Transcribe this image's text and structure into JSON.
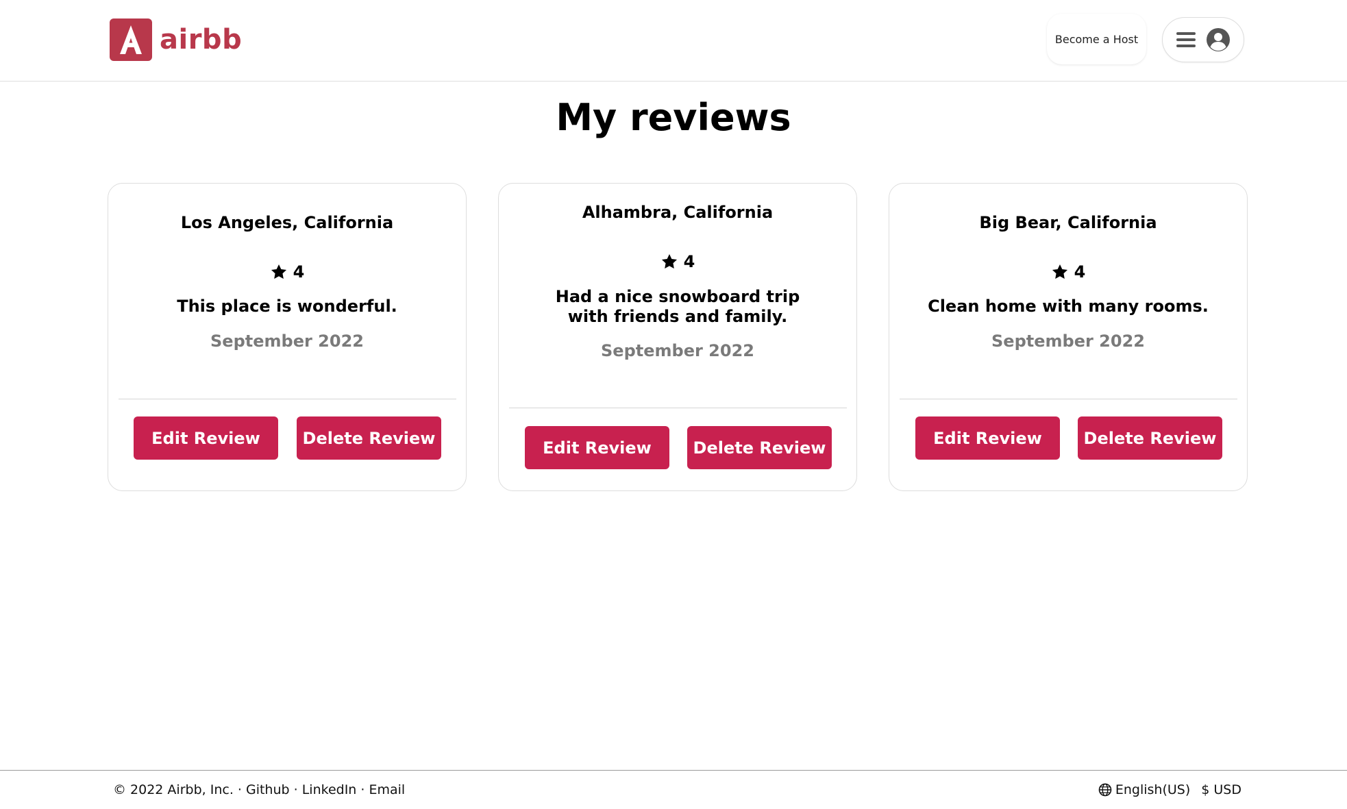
{
  "header": {
    "logo_letter": "A",
    "logo_text": "airbb",
    "become_host_label": "Become a Host",
    "brand_color": "#b8384b"
  },
  "main": {
    "title": "My reviews",
    "reviews": [
      {
        "location": "Los Angeles, California",
        "rating": "4",
        "text": "This place is wonderful.",
        "date": "September 2022",
        "edit_label": "Edit Review",
        "delete_label": "Delete Review"
      },
      {
        "location": "Alhambra, California",
        "rating": "4",
        "text": "Had a nice snowboard trip with friends and family.",
        "date": "September 2022",
        "edit_label": "Edit Review",
        "delete_label": "Delete Review"
      },
      {
        "location": "Big Bear, California",
        "rating": "4",
        "text": "Clean home with many rooms.",
        "date": "September 2022",
        "edit_label": "Edit Review",
        "delete_label": "Delete Review"
      }
    ],
    "button_color": "#c8214f"
  },
  "footer": {
    "copyright": "© 2022 Airbb, Inc.",
    "sep1": " · ",
    "github": "Github",
    "sep2": " · ",
    "linkedin": "LinkedIn",
    "sep3": " · ",
    "email": "Email",
    "language": "English(US)",
    "currency": "$ USD"
  },
  "icons": {
    "logo": "airbb-logo-icon",
    "menu": "hamburger-menu-icon",
    "avatar": "user-avatar-icon",
    "star": "star-icon",
    "globe": "globe-icon"
  }
}
